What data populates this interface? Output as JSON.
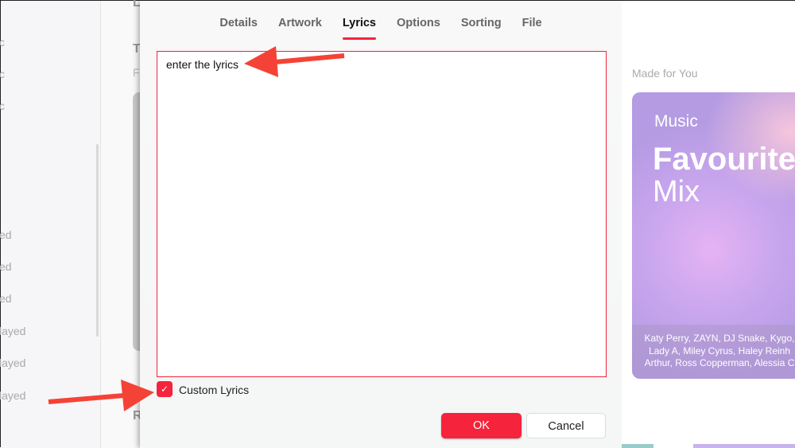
{
  "sidebar": {
    "items": [
      "c",
      "c",
      "c",
      "ed",
      "ed",
      "ed",
      "layed",
      "layed",
      "layed"
    ]
  },
  "background": {
    "letters": [
      "L",
      "T",
      "F",
      "R"
    ]
  },
  "dialog": {
    "tabs": [
      {
        "label": "Details"
      },
      {
        "label": "Artwork"
      },
      {
        "label": "Lyrics",
        "active": true
      },
      {
        "label": "Options"
      },
      {
        "label": "Sorting"
      },
      {
        "label": "File"
      }
    ],
    "lyrics_value": "enter the lyrics",
    "custom_lyrics_label": "Custom Lyrics",
    "custom_lyrics_checked": true,
    "ok_label": "OK",
    "cancel_label": "Cancel"
  },
  "right": {
    "section_title": "Made for You",
    "card": {
      "brand": "Music",
      "title": "Favourites",
      "subtitle": "Mix",
      "artists": [
        "Katy Perry, ZAYN, DJ Snake, Kygo,",
        "Lady A, Miley Cyrus, Haley Reinh",
        "Arthur, Ross Copperman, Alessia C"
      ]
    }
  },
  "colors": {
    "accent": "#f5233b",
    "annotation": "#f44336"
  }
}
